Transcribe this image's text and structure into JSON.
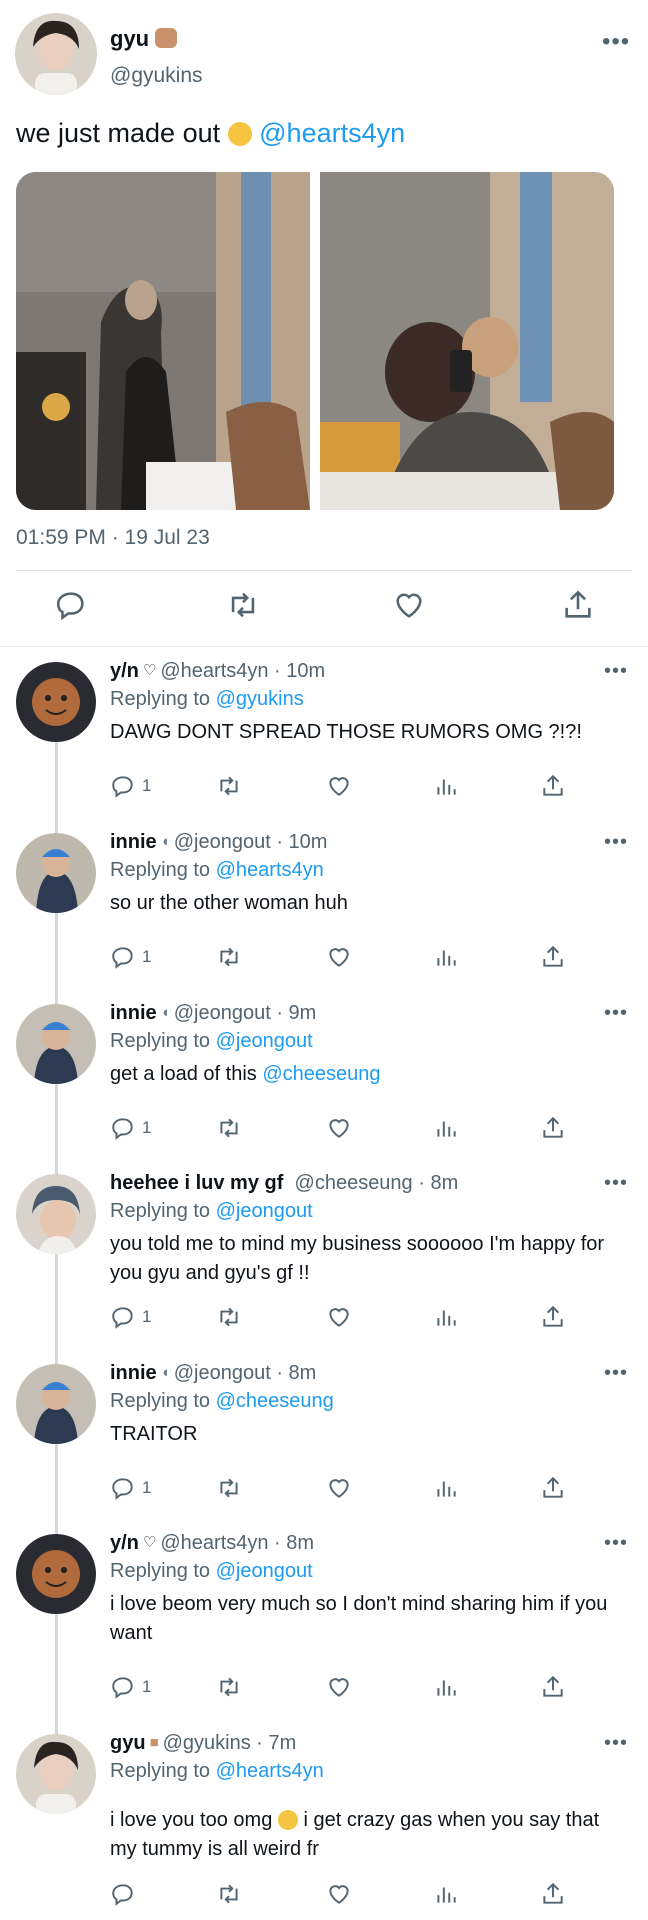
{
  "main_tweet": {
    "display_name": "gyu",
    "name_emoji": "fist-emoji",
    "handle": "@gyukins",
    "text": "we just made out",
    "text_emoji": "rofl-emoji",
    "mention": "@hearts4yn",
    "timestamp": "01:59 PM · 19 Jul 23",
    "actions": [
      "reply-icon",
      "retweet-icon",
      "like-icon",
      "share-icon"
    ]
  },
  "replies": [
    {
      "name": "y/n",
      "name_emoji": "white-heart-emoji",
      "handle_time": "@hearts4yn · 10m",
      "replying_label": "Replying to",
      "replying_to": "@gyukins",
      "text": "DAWG DONT SPREAD THOSE RUMORS OMG ?!?!",
      "reply_count": "1"
    },
    {
      "name": "innie",
      "name_emoji": "speaking-head-emoji",
      "handle_time": "@jeongout · 10m",
      "replying_label": "Replying to",
      "replying_to": "@hearts4yn",
      "text": "so ur the other woman huh",
      "reply_count": "1"
    },
    {
      "name": "innie",
      "name_emoji": "speaking-head-emoji",
      "handle_time": "@jeongout · 9m",
      "replying_label": "Replying to",
      "replying_to": "@jeongout",
      "text": "get a load of this",
      "text_mention": "@cheeseung",
      "reply_count": "1"
    },
    {
      "name": "heehee i luv my gf",
      "name_emoji": "",
      "handle_time": "@cheeseung · 8m",
      "replying_label": "Replying to",
      "replying_to": "@jeongout",
      "text": "you told me to mind my business soooooo I'm happy for you gyu and gyu's gf !!",
      "reply_count": "1"
    },
    {
      "name": "innie",
      "name_emoji": "speaking-head-emoji",
      "handle_time": "@jeongout · 8m",
      "replying_label": "Replying to",
      "replying_to": "@cheeseung",
      "text": "TRAITOR",
      "reply_count": "1"
    },
    {
      "name": "y/n",
      "name_emoji": "white-heart-emoji",
      "handle_time": "@hearts4yn · 8m",
      "replying_label": "Replying to",
      "replying_to": "@jeongout",
      "text": "i love beom very much so I don't mind sharing him if you want",
      "reply_count": "1"
    },
    {
      "name": "gyu",
      "name_emoji": "fist-emoji",
      "handle_time": "@gyukins · 7m",
      "replying_label": "Replying to",
      "replying_to": "@hearts4yn",
      "text_part1": "i love you too omg",
      "text_emoji": "grimacing-emoji",
      "text_part2": "i get crazy gas when you say that my tummy is all weird fr",
      "reply_count": ""
    }
  ],
  "colors": {
    "link": "#1d9bf0",
    "secondary_text": "#536471",
    "divider": "#e4e8eb",
    "thread_line": "#cfd9de"
  }
}
